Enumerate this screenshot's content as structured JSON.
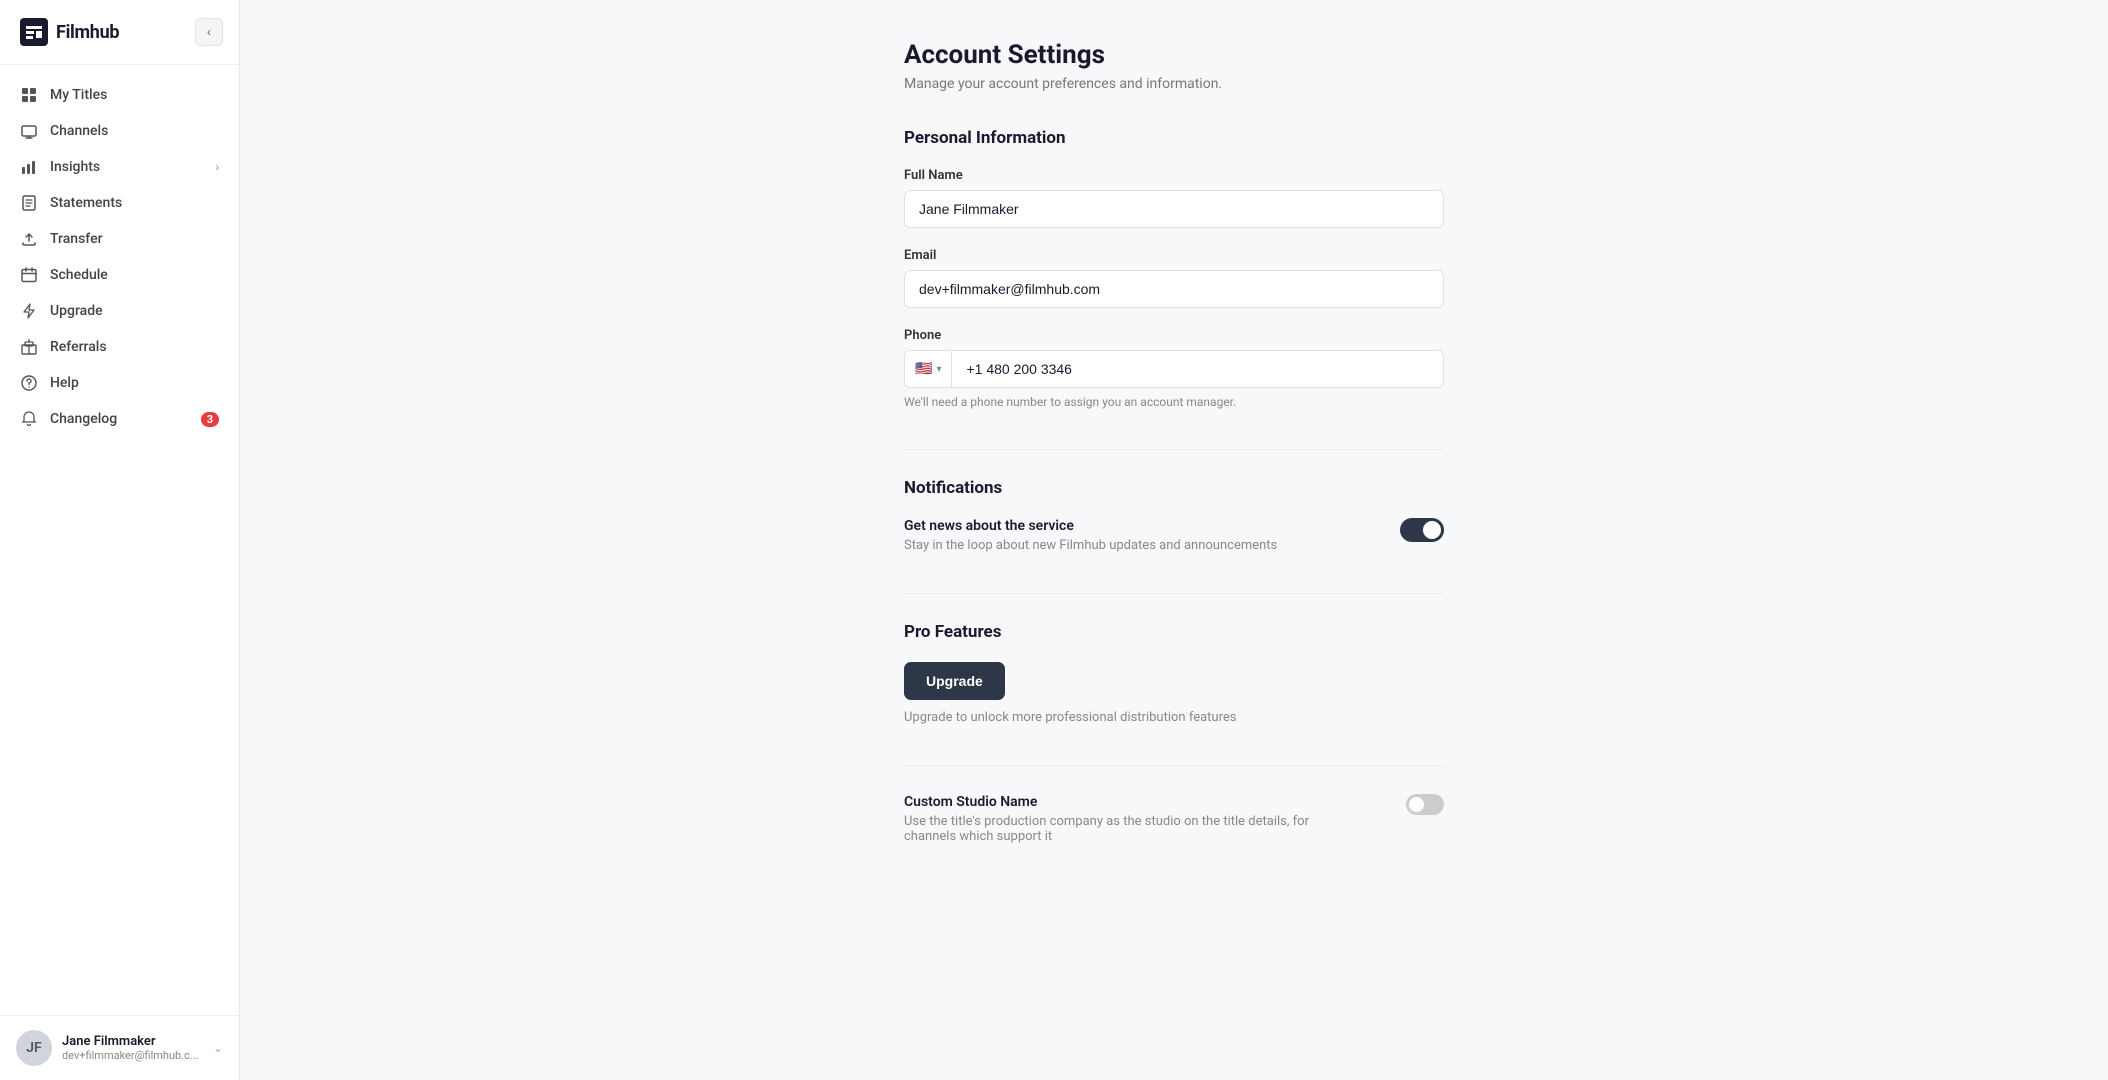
{
  "app": {
    "name": "Filmhub"
  },
  "sidebar": {
    "collapse_btn_label": "‹",
    "nav_items": [
      {
        "id": "my-titles",
        "label": "My Titles",
        "icon": "grid",
        "has_chevron": false,
        "badge": null
      },
      {
        "id": "channels",
        "label": "Channels",
        "icon": "tv",
        "has_chevron": false,
        "badge": null
      },
      {
        "id": "insights",
        "label": "Insights",
        "icon": "bar-chart",
        "has_chevron": true,
        "badge": null
      },
      {
        "id": "statements",
        "label": "Statements",
        "icon": "file-text",
        "has_chevron": false,
        "badge": null
      },
      {
        "id": "transfer",
        "label": "Transfer",
        "icon": "upload",
        "has_chevron": false,
        "badge": null
      },
      {
        "id": "schedule",
        "label": "Schedule",
        "icon": "calendar",
        "has_chevron": false,
        "badge": null
      },
      {
        "id": "upgrade",
        "label": "Upgrade",
        "icon": "zap",
        "has_chevron": false,
        "badge": null
      },
      {
        "id": "referrals",
        "label": "Referrals",
        "icon": "gift",
        "has_chevron": false,
        "badge": null
      },
      {
        "id": "help",
        "label": "Help",
        "icon": "help-circle",
        "has_chevron": false,
        "badge": null
      },
      {
        "id": "changelog",
        "label": "Changelog",
        "icon": "bell",
        "has_chevron": false,
        "badge": "3"
      }
    ],
    "user": {
      "name": "Jane Filmmaker",
      "email": "dev+filmmaker@filmhub.c..."
    }
  },
  "page": {
    "title": "Account Settings",
    "subtitle": "Manage your account preferences and information."
  },
  "personal_info": {
    "section_title": "Personal Information",
    "full_name_label": "Full Name",
    "full_name_value": "Jane Filmmaker",
    "email_label": "Email",
    "email_value": "dev+filmmaker@filmhub.com",
    "phone_label": "Phone",
    "phone_country_flag": "🇺🇸",
    "phone_country_code": "+1",
    "phone_number": "480 200 3346",
    "phone_hint": "We'll need a phone number to assign you an account manager."
  },
  "notifications": {
    "section_title": "Notifications",
    "items": [
      {
        "id": "news",
        "title": "Get news about the service",
        "description": "Stay in the loop about new Filmhub updates and announcements",
        "enabled": true
      }
    ]
  },
  "pro_features": {
    "section_title": "Pro Features",
    "upgrade_button_label": "Upgrade",
    "upgrade_description": "Upgrade to unlock more professional distribution features"
  },
  "custom_studio": {
    "section_title": "Custom Studio Name",
    "description": "Use the title's production company as the studio on the title details, for channels which support it",
    "enabled": false
  }
}
